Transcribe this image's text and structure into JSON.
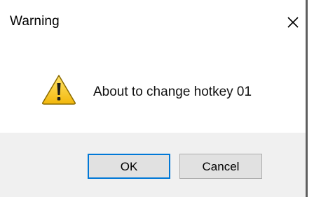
{
  "dialog": {
    "title": "Warning",
    "close_icon": "close-icon",
    "message": "About to change hotkey 01",
    "message_icon": "warning-icon",
    "ok_label": "OK",
    "cancel_label": "Cancel"
  },
  "colors": {
    "footer_background": "#f0f0f0",
    "default_button_border": "#0078d7",
    "warning_yellow": "#f7c520",
    "warning_outline": "#7a5a00"
  }
}
